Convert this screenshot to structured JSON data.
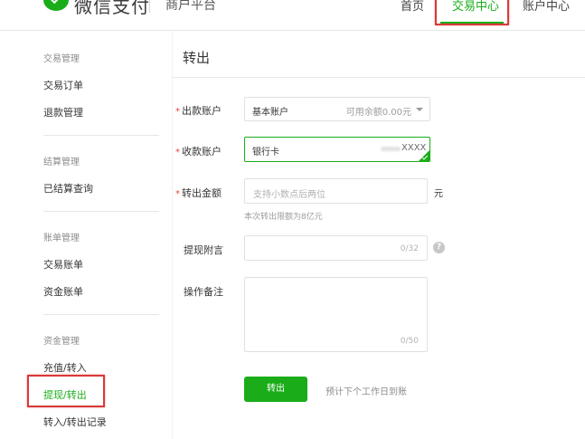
{
  "header": {
    "brand": "微信支付",
    "portal": "商户平台",
    "nav": [
      {
        "label": "首页"
      },
      {
        "label": "交易中心"
      },
      {
        "label": "账户中心"
      }
    ]
  },
  "sidebar": {
    "groups": [
      {
        "title": "交易管理",
        "items": [
          "交易订单",
          "退款管理"
        ]
      },
      {
        "title": "结算管理",
        "items": [
          "已结算查询"
        ]
      },
      {
        "title": "账单管理",
        "items": [
          "交易账单",
          "资金账单"
        ]
      },
      {
        "title": "资金管理",
        "items": [
          "充值/转入",
          "提现/转出",
          "转入/转出记录"
        ]
      }
    ]
  },
  "main": {
    "title": "转出",
    "form": {
      "required_mark": "*",
      "out_account": {
        "label": "出款账户",
        "value": "基本账户",
        "hint": "可用余额0.00元"
      },
      "in_account": {
        "label": "收款账户",
        "value": "银行卡",
        "tail": "XXXX"
      },
      "amount": {
        "label": "转出金额",
        "placeholder": "支持小数点后两位",
        "unit": "元",
        "limit_hint": "本次转出限额为8亿元"
      },
      "attach": {
        "label": "提现附言",
        "counter": "0/32",
        "help": "?"
      },
      "remark": {
        "label": "操作备注",
        "counter": "0/50"
      },
      "submit": "转出",
      "submit_note": "预计下个工作日到账"
    }
  },
  "colors": {
    "accent": "#1aad19",
    "highlight_border": "#d73a3a"
  }
}
